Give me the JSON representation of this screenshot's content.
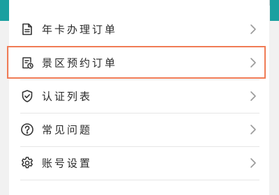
{
  "colors": {
    "highlight_border": "#f07b55",
    "accent_edge": "#1aa0a0",
    "text": "#2a2a2a",
    "chevron": "#9a9a9a"
  },
  "menu": {
    "items": [
      {
        "label": "年卡办理订单",
        "icon": "document-icon"
      },
      {
        "label": "景区预约订单",
        "icon": "calendar-clock-icon",
        "highlighted": true
      },
      {
        "label": "认证列表",
        "icon": "shield-check-icon"
      },
      {
        "label": "常见问题",
        "icon": "question-circle-icon"
      },
      {
        "label": "账号设置",
        "icon": "gear-icon"
      }
    ]
  }
}
